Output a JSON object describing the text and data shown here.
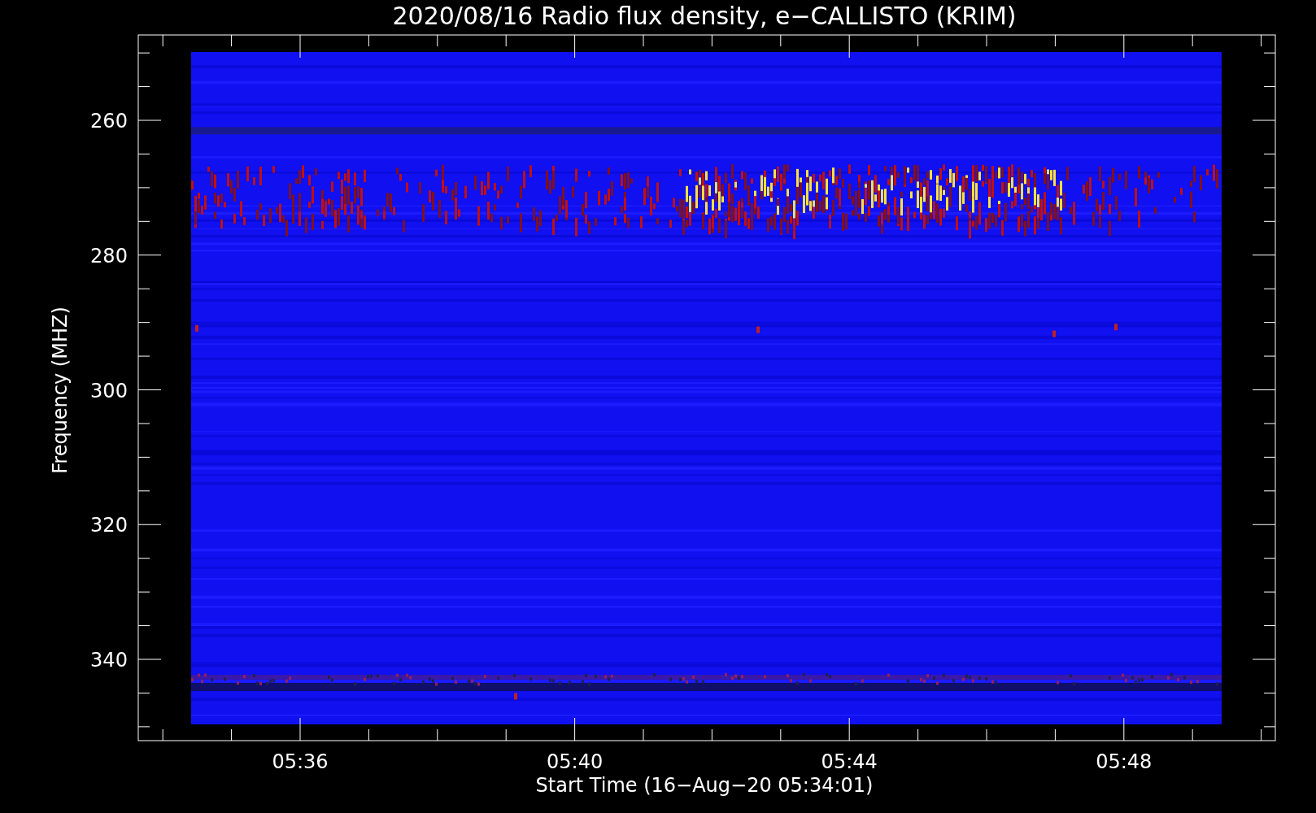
{
  "title": "2020/08/16  Radio flux density, e−CALLISTO (KRIM)",
  "plot": {
    "ylabel": "Frequency (MHZ)",
    "xlabel": "Start Time (16−Aug−20 05:34:01)",
    "ytick_labels": [
      "260",
      "280",
      "300",
      "320",
      "340"
    ],
    "xtick_labels": [
      "05:36",
      "05:40",
      "05:44",
      "05:48"
    ]
  }
}
